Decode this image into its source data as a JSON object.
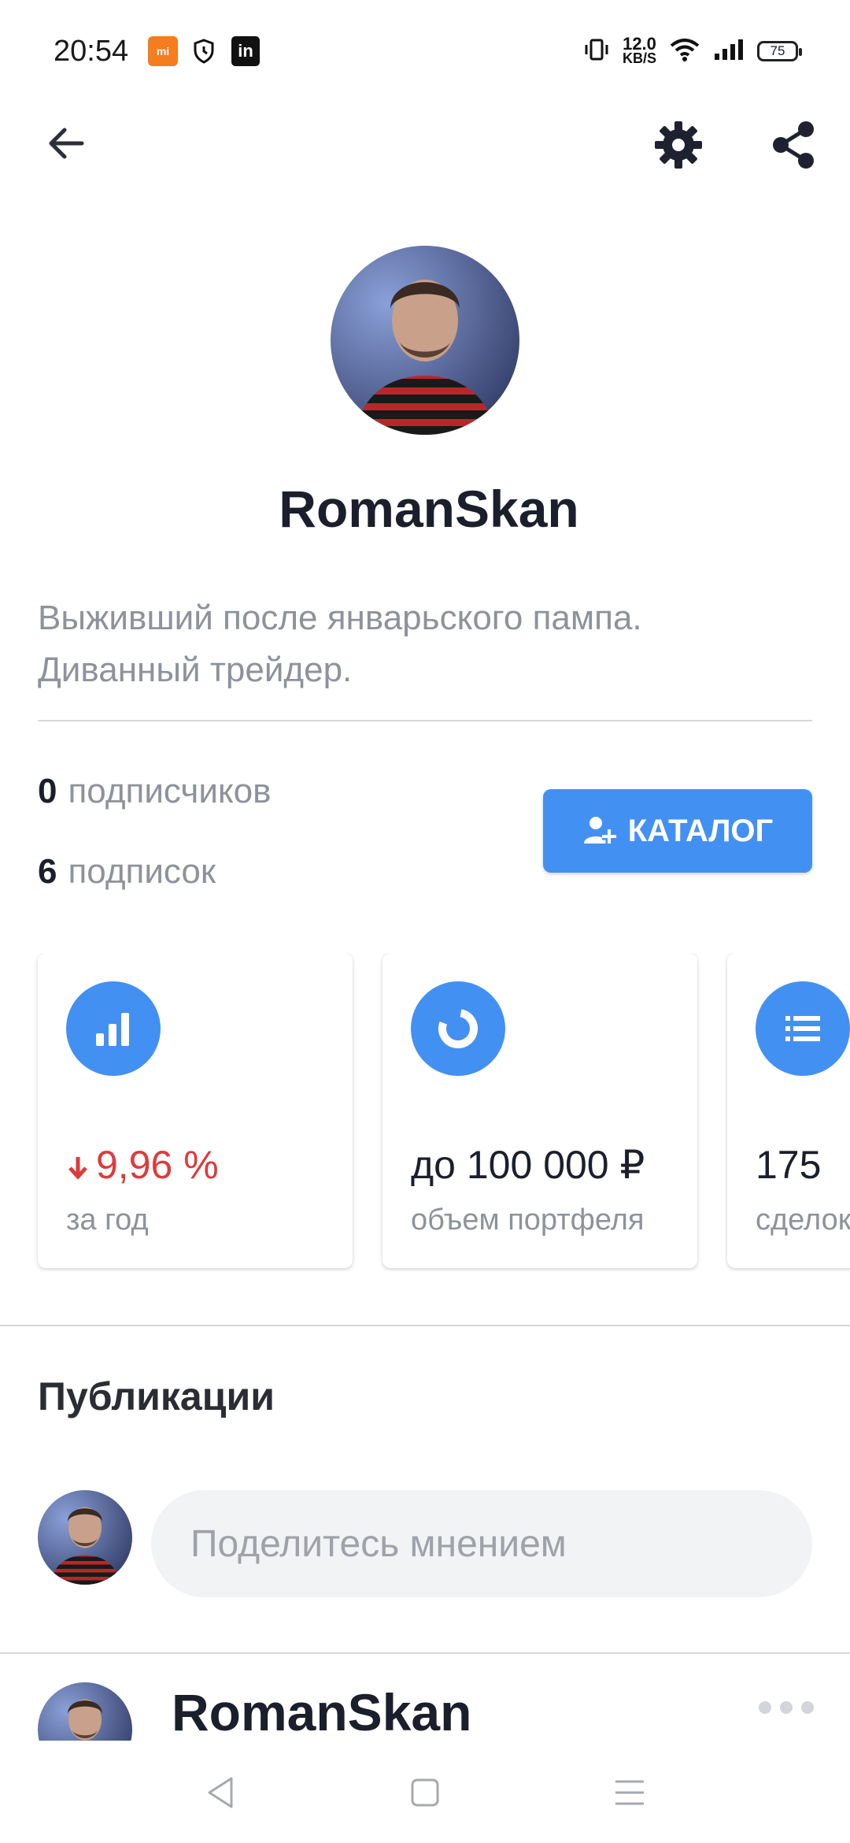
{
  "status_bar": {
    "time": "20:54",
    "speed_value": "12.0",
    "speed_unit": "KB/S",
    "battery": "75"
  },
  "profile": {
    "username": "RomanSkan",
    "bio_line1": "Выживший после январьского пампа.",
    "bio_line2": "Диванный трейдер.",
    "followers_count": "0",
    "followers_label": "подписчиков",
    "subscriptions_count": "6",
    "subscriptions_label": "подписок",
    "catalog_button": "КАТАЛОГ"
  },
  "cards": [
    {
      "icon": "bar-chart-icon",
      "value": "9,96 %",
      "label": "за год",
      "trend": "down",
      "color": "#de3a3a"
    },
    {
      "icon": "donut-chart-icon",
      "value": "до 100 000 ₽",
      "label": "объем портфеля"
    },
    {
      "icon": "list-icon",
      "value": "175",
      "label": "сделок"
    }
  ],
  "publications": {
    "title": "Публикации",
    "composer_placeholder": "Поделитесь мнением",
    "post_author": "RomanSkan"
  },
  "colors": {
    "accent": "#4390f3",
    "negative": "#de3a3a",
    "muted_text": "#8d929b"
  }
}
